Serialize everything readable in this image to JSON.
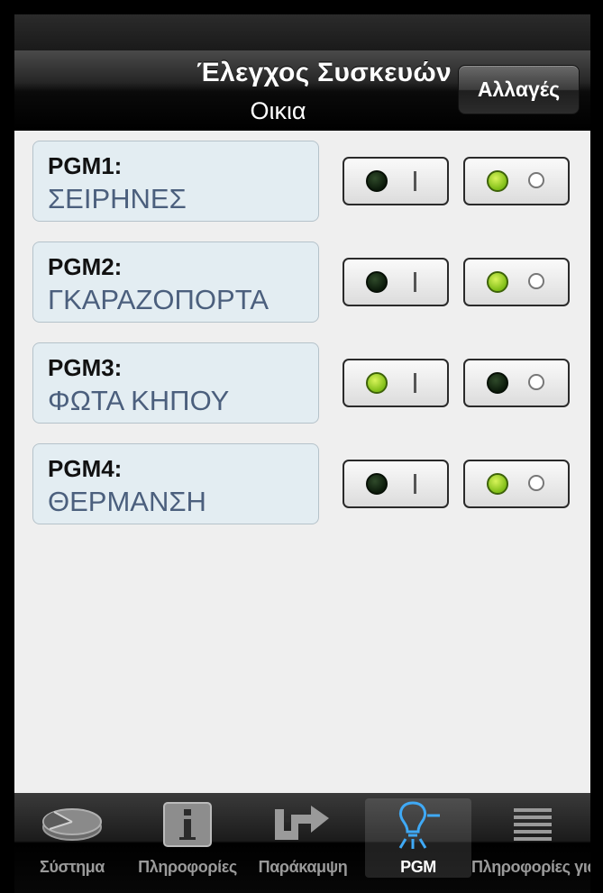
{
  "header": {
    "title": "Έλεγχος Συσκευών",
    "subtitle": "Οικια",
    "edit_label": "Αλλαγές"
  },
  "pgms": [
    {
      "name": "PGM1:",
      "description": "ΣΕΙΡΗΝΕΣ",
      "state": "off"
    },
    {
      "name": "PGM2:",
      "description": "ΓΚΑΡΑΖΟΠΟΡΤΑ",
      "state": "off"
    },
    {
      "name": "PGM3:",
      "description": "ΦΩΤΑ ΚΗΠΟΥ",
      "state": "on"
    },
    {
      "name": "PGM4:",
      "description": "ΘΕΡΜΑΝΣΗ",
      "state": "off"
    }
  ],
  "tabs": [
    {
      "label": "Σύστημα",
      "icon": "pie-chart-icon",
      "active": false
    },
    {
      "label": "Πληροφορίες",
      "icon": "info-icon",
      "active": false
    },
    {
      "label": "Παράκαμψη",
      "icon": "bypass-arrow-icon",
      "active": false
    },
    {
      "label": "PGM",
      "icon": "light-bulb-icon",
      "active": true
    },
    {
      "label": "Πληροφορίες για",
      "icon": "list-icon",
      "active": false
    }
  ],
  "colors": {
    "led_on": "#8cc51d",
    "led_off": "#14260f",
    "active_tab_icon": "#3fa9f5",
    "card_bg": "#e3edf2",
    "desc_text": "#4b5f7d"
  }
}
